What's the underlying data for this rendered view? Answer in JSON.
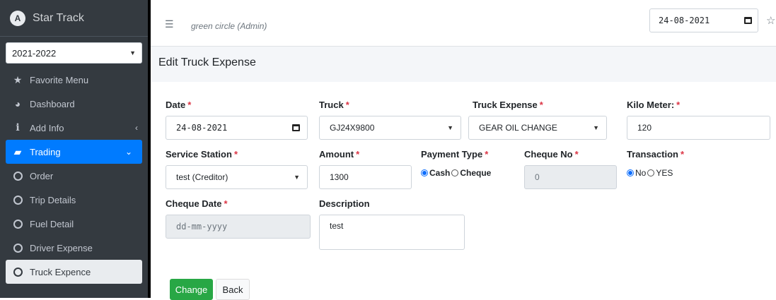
{
  "sidebar": {
    "brand": "Star Track",
    "logo_letter": "A",
    "year": "2021-2022",
    "items": [
      {
        "label": "Favorite Menu",
        "icon": "star-icon"
      },
      {
        "label": "Dashboard",
        "icon": "dashboard-icon"
      },
      {
        "label": "Add Info",
        "icon": "info-icon"
      },
      {
        "label": "Trading",
        "icon": "briefcase-icon"
      },
      {
        "label": "Order",
        "icon": "circle-icon"
      },
      {
        "label": "Trip Details",
        "icon": "circle-icon"
      },
      {
        "label": "Fuel Detail",
        "icon": "circle-icon"
      },
      {
        "label": "Driver Expense",
        "icon": "circle-icon"
      },
      {
        "label": "Truck Expence",
        "icon": "circle-icon"
      }
    ]
  },
  "topbar": {
    "user": "green circle (Admin)",
    "date": "24-08-2021"
  },
  "page": {
    "title": "Edit Truck Expense"
  },
  "form": {
    "date": {
      "label": "Date",
      "value": "24-08-2021"
    },
    "truck": {
      "label": "Truck",
      "value": "GJ24X9800"
    },
    "truck_expense": {
      "label": "Truck Expense",
      "value": "GEAR OIL CHANGE"
    },
    "kilo_meter": {
      "label": "Kilo Meter:",
      "value": "120"
    },
    "service_station": {
      "label": "Service Station",
      "value": "test (Creditor)"
    },
    "amount": {
      "label": "Amount",
      "value": "1300"
    },
    "payment_type": {
      "label": "Payment Type",
      "options": [
        "Cash",
        "Cheque"
      ],
      "selected": "Cash"
    },
    "cheque_no": {
      "label": "Cheque No",
      "value": "0"
    },
    "transaction": {
      "label": "Transaction",
      "options": [
        "No",
        "YES"
      ],
      "selected": "No"
    },
    "cheque_date": {
      "label": "Cheque Date",
      "placeholder": "dd-mm-yyyy"
    },
    "description": {
      "label": "Description",
      "value": "test"
    },
    "required_mark": "*"
  },
  "buttons": {
    "change": "Change",
    "back": "Back"
  },
  "colors": {
    "sidebar": "#343a40",
    "active": "#007bff",
    "success": "#28a745",
    "required": "#dc3545"
  }
}
